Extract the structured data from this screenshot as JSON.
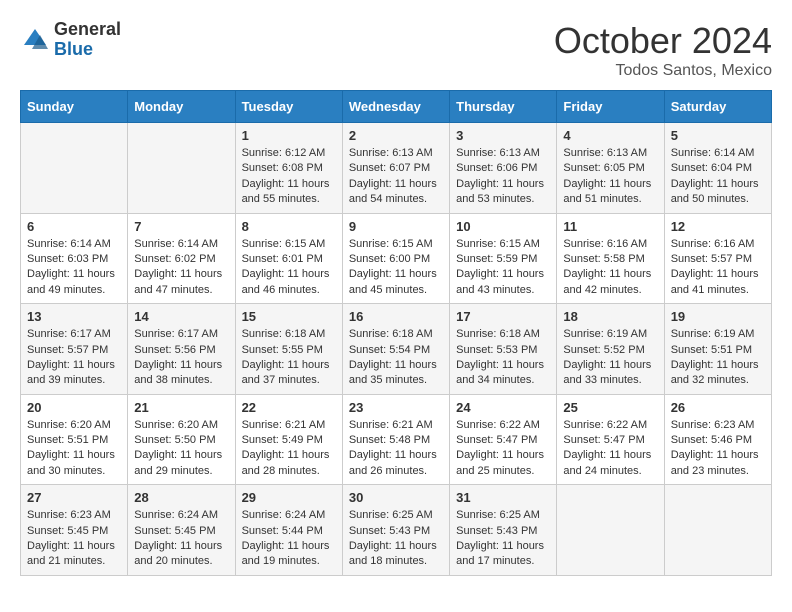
{
  "header": {
    "logo_line1": "General",
    "logo_line2": "Blue",
    "month": "October 2024",
    "location": "Todos Santos, Mexico"
  },
  "days_of_week": [
    "Sunday",
    "Monday",
    "Tuesday",
    "Wednesday",
    "Thursday",
    "Friday",
    "Saturday"
  ],
  "weeks": [
    [
      {
        "day": "",
        "content": ""
      },
      {
        "day": "",
        "content": ""
      },
      {
        "day": "1",
        "content": "Sunrise: 6:12 AM\nSunset: 6:08 PM\nDaylight: 11 hours and 55 minutes."
      },
      {
        "day": "2",
        "content": "Sunrise: 6:13 AM\nSunset: 6:07 PM\nDaylight: 11 hours and 54 minutes."
      },
      {
        "day": "3",
        "content": "Sunrise: 6:13 AM\nSunset: 6:06 PM\nDaylight: 11 hours and 53 minutes."
      },
      {
        "day": "4",
        "content": "Sunrise: 6:13 AM\nSunset: 6:05 PM\nDaylight: 11 hours and 51 minutes."
      },
      {
        "day": "5",
        "content": "Sunrise: 6:14 AM\nSunset: 6:04 PM\nDaylight: 11 hours and 50 minutes."
      }
    ],
    [
      {
        "day": "6",
        "content": "Sunrise: 6:14 AM\nSunset: 6:03 PM\nDaylight: 11 hours and 49 minutes."
      },
      {
        "day": "7",
        "content": "Sunrise: 6:14 AM\nSunset: 6:02 PM\nDaylight: 11 hours and 47 minutes."
      },
      {
        "day": "8",
        "content": "Sunrise: 6:15 AM\nSunset: 6:01 PM\nDaylight: 11 hours and 46 minutes."
      },
      {
        "day": "9",
        "content": "Sunrise: 6:15 AM\nSunset: 6:00 PM\nDaylight: 11 hours and 45 minutes."
      },
      {
        "day": "10",
        "content": "Sunrise: 6:15 AM\nSunset: 5:59 PM\nDaylight: 11 hours and 43 minutes."
      },
      {
        "day": "11",
        "content": "Sunrise: 6:16 AM\nSunset: 5:58 PM\nDaylight: 11 hours and 42 minutes."
      },
      {
        "day": "12",
        "content": "Sunrise: 6:16 AM\nSunset: 5:57 PM\nDaylight: 11 hours and 41 minutes."
      }
    ],
    [
      {
        "day": "13",
        "content": "Sunrise: 6:17 AM\nSunset: 5:57 PM\nDaylight: 11 hours and 39 minutes."
      },
      {
        "day": "14",
        "content": "Sunrise: 6:17 AM\nSunset: 5:56 PM\nDaylight: 11 hours and 38 minutes."
      },
      {
        "day": "15",
        "content": "Sunrise: 6:18 AM\nSunset: 5:55 PM\nDaylight: 11 hours and 37 minutes."
      },
      {
        "day": "16",
        "content": "Sunrise: 6:18 AM\nSunset: 5:54 PM\nDaylight: 11 hours and 35 minutes."
      },
      {
        "day": "17",
        "content": "Sunrise: 6:18 AM\nSunset: 5:53 PM\nDaylight: 11 hours and 34 minutes."
      },
      {
        "day": "18",
        "content": "Sunrise: 6:19 AM\nSunset: 5:52 PM\nDaylight: 11 hours and 33 minutes."
      },
      {
        "day": "19",
        "content": "Sunrise: 6:19 AM\nSunset: 5:51 PM\nDaylight: 11 hours and 32 minutes."
      }
    ],
    [
      {
        "day": "20",
        "content": "Sunrise: 6:20 AM\nSunset: 5:51 PM\nDaylight: 11 hours and 30 minutes."
      },
      {
        "day": "21",
        "content": "Sunrise: 6:20 AM\nSunset: 5:50 PM\nDaylight: 11 hours and 29 minutes."
      },
      {
        "day": "22",
        "content": "Sunrise: 6:21 AM\nSunset: 5:49 PM\nDaylight: 11 hours and 28 minutes."
      },
      {
        "day": "23",
        "content": "Sunrise: 6:21 AM\nSunset: 5:48 PM\nDaylight: 11 hours and 26 minutes."
      },
      {
        "day": "24",
        "content": "Sunrise: 6:22 AM\nSunset: 5:47 PM\nDaylight: 11 hours and 25 minutes."
      },
      {
        "day": "25",
        "content": "Sunrise: 6:22 AM\nSunset: 5:47 PM\nDaylight: 11 hours and 24 minutes."
      },
      {
        "day": "26",
        "content": "Sunrise: 6:23 AM\nSunset: 5:46 PM\nDaylight: 11 hours and 23 minutes."
      }
    ],
    [
      {
        "day": "27",
        "content": "Sunrise: 6:23 AM\nSunset: 5:45 PM\nDaylight: 11 hours and 21 minutes."
      },
      {
        "day": "28",
        "content": "Sunrise: 6:24 AM\nSunset: 5:45 PM\nDaylight: 11 hours and 20 minutes."
      },
      {
        "day": "29",
        "content": "Sunrise: 6:24 AM\nSunset: 5:44 PM\nDaylight: 11 hours and 19 minutes."
      },
      {
        "day": "30",
        "content": "Sunrise: 6:25 AM\nSunset: 5:43 PM\nDaylight: 11 hours and 18 minutes."
      },
      {
        "day": "31",
        "content": "Sunrise: 6:25 AM\nSunset: 5:43 PM\nDaylight: 11 hours and 17 minutes."
      },
      {
        "day": "",
        "content": ""
      },
      {
        "day": "",
        "content": ""
      }
    ]
  ]
}
